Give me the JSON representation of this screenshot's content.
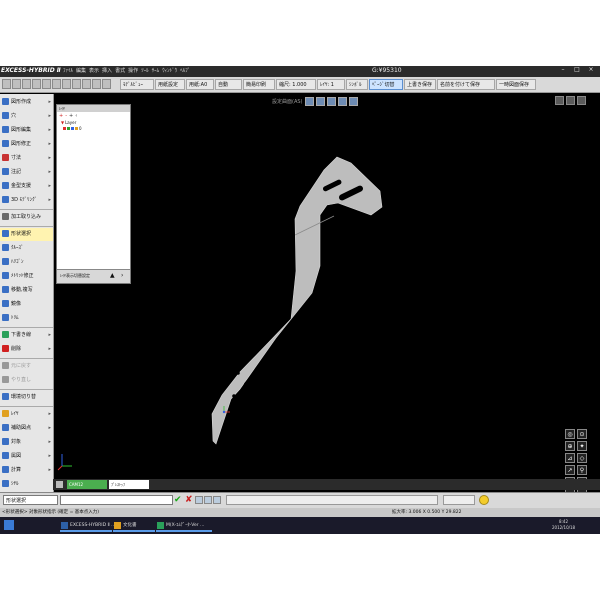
{
  "title_bar": {
    "app_logo": "EXCESS-HYBRID Ⅱ",
    "menus": [
      "ﾌｧｲﾙ",
      "編集",
      "表示",
      "挿入",
      "書式",
      "操作",
      "ﾂｰﾙ",
      "ｻｰﾑ",
      "ｳｨﾝﾄﾞｳ",
      "ﾍﾙﾌﾟ"
    ],
    "document": "G:¥95310",
    "window_controls": [
      "–",
      "□",
      "×"
    ]
  },
  "toolbar": {
    "buttons": [
      {
        "label": "ﾓﾃﾞﾙﾋﾞｭｰ",
        "blue": false
      },
      {
        "label": "用紙設定",
        "blue": false
      },
      {
        "label": "用紙:A0",
        "blue": false
      },
      {
        "label": "自動",
        "blue": false
      },
      {
        "label": "簡易印刷",
        "blue": false
      },
      {
        "label": "縮尺: 1.000",
        "blue": false
      },
      {
        "label": "ﾚｲﾔ: 1",
        "blue": false
      },
      {
        "label": "ｼﾝﾎﾞﾙ",
        "blue": false
      },
      {
        "label": "ﾍﾟｰｼﾞ切替",
        "blue": true
      },
      {
        "label": "上書き保存",
        "blue": false
      },
      {
        "label": "名前を付けて保存",
        "blue": false
      },
      {
        "label": "一時図面保存",
        "blue": false
      }
    ]
  },
  "viewbar": {
    "label": "設定曲面(AS)"
  },
  "left_panel": {
    "items": [
      {
        "label": "図形作成",
        "icon": "pencil-icon",
        "color": "#3a6fc4",
        "arrow": true
      },
      {
        "label": "穴",
        "icon": "hole-icon",
        "color": "#3a6fc4",
        "arrow": true
      },
      {
        "label": "図形編集",
        "icon": "edit-shape-icon",
        "color": "#3a6fc4",
        "arrow": true
      },
      {
        "label": "図形修正",
        "icon": "modify-icon",
        "color": "#3a6fc4",
        "arrow": true
      },
      {
        "label": "寸法",
        "icon": "dimension-icon",
        "color": "#c83232",
        "arrow": true
      },
      {
        "label": "注記",
        "icon": "note-icon",
        "color": "#3a6fc4",
        "arrow": true
      },
      {
        "label": "金型支援",
        "icon": "mold-icon",
        "color": "#3a6fc4",
        "arrow": true
      },
      {
        "label": "3D ﾓﾃﾞﾘﾝｸﾞ",
        "icon": "modeling-3d-icon",
        "color": "#3a6fc4",
        "arrow": true
      },
      {
        "label": "加工取り込み",
        "icon": "import-icon",
        "color": "#6a6a6a",
        "arrow": false
      },
      {
        "label": "形状選択",
        "icon": "shape-select-icon",
        "color": "#3a6fc4",
        "arrow": false,
        "selected": true
      },
      {
        "label": "ｸﾙｰｽﾞ",
        "icon": "cruise-icon",
        "color": "#3a6fc4",
        "arrow": false
      },
      {
        "label": "ﾊﾘｺﾞﾝ",
        "icon": "polygon-icon",
        "color": "#3a6fc4",
        "arrow": false
      },
      {
        "label": "ﾒﾄﾘｯﾄ修正",
        "icon": "metric-icon",
        "color": "#3a6fc4",
        "arrow": false
      },
      {
        "label": "移動,複写",
        "icon": "move-copy-icon",
        "color": "#3a6fc4",
        "arrow": false
      },
      {
        "label": "鏡像",
        "icon": "mirror-icon",
        "color": "#3a6fc4",
        "arrow": false
      },
      {
        "label": "ﾄﾘﾑ",
        "icon": "trim-icon",
        "color": "#3a6fc4",
        "arrow": false
      },
      {
        "label": "下書き線",
        "icon": "draft-line-icon",
        "color": "#2aa05a",
        "arrow": true
      },
      {
        "label": "削除",
        "icon": "delete-icon",
        "color": "#d02020",
        "arrow": true
      },
      {
        "label": "元に戻す",
        "icon": "undo-icon",
        "color": "#999999",
        "arrow": false,
        "dim": true
      },
      {
        "label": "やり直し",
        "icon": "redo-icon",
        "color": "#999999",
        "arrow": false,
        "dim": true
      },
      {
        "label": "環境切り替",
        "icon": "environment-icon",
        "color": "#3a6fc4",
        "arrow": false
      },
      {
        "label": "ﾚｲﾔ",
        "icon": "layer-icon",
        "color": "#e0a020",
        "arrow": true
      },
      {
        "label": "補助図点",
        "icon": "aux-point-icon",
        "color": "#3a6fc4",
        "arrow": true
      },
      {
        "label": "対象",
        "icon": "target-icon",
        "color": "#3a6fc4",
        "arrow": true
      },
      {
        "label": "属図",
        "icon": "attribute-icon",
        "color": "#3a6fc4",
        "arrow": true
      },
      {
        "label": "計算",
        "icon": "calculate-icon",
        "color": "#3a6fc4",
        "arrow": true
      },
      {
        "label": "ｼﾔﾙ",
        "icon": "mail-icon",
        "color": "#3a6fc4",
        "arrow": false
      }
    ]
  },
  "layer_dialog": {
    "title": "ﾚｲﾔ",
    "tools": [
      "+",
      "-",
      "+",
      "‹"
    ],
    "tree": [
      "Layer",
      "0"
    ],
    "swatch_colors": [
      "#e03030",
      "#30a030",
      "#3060e0",
      "#e0a020"
    ],
    "footer_label": "ﾚｲﾔ表示切替設定"
  },
  "tabs": [
    "CAM12",
    "ﾌﾟﾚｽﾄｯﾌ"
  ],
  "command_row": {
    "field_value": "形状選択",
    "ok_symbol": "✔",
    "ng_symbol": "✘"
  },
  "status_row": {
    "left": "<形状選択> 対象形状指示 (確定 = 基本点入力)",
    "right": "拡大率: 3.006 X 0.500 Y 29.822"
  },
  "taskbar": {
    "items": [
      {
        "label": "EXCESS-HYBRID Ⅱ ...",
        "color": "#2d5fa6"
      },
      {
        "label": "文化書",
        "color": "#e0a020"
      },
      {
        "label": "M(X-ｺﾑﾃﾞｰﾀ-Ver ...",
        "color": "#2aa05a"
      }
    ],
    "time": "8:42",
    "date": "2012/10/18"
  },
  "snap_icons": [
    "◎",
    "⊙",
    "⊕",
    "✦",
    "⊿",
    "◇",
    "↗",
    "⚲",
    "↘",
    "⌧",
    "⌖",
    "⚪"
  ],
  "colors": {
    "part_fill": "#bdbdbd",
    "viewport": "#000000"
  }
}
